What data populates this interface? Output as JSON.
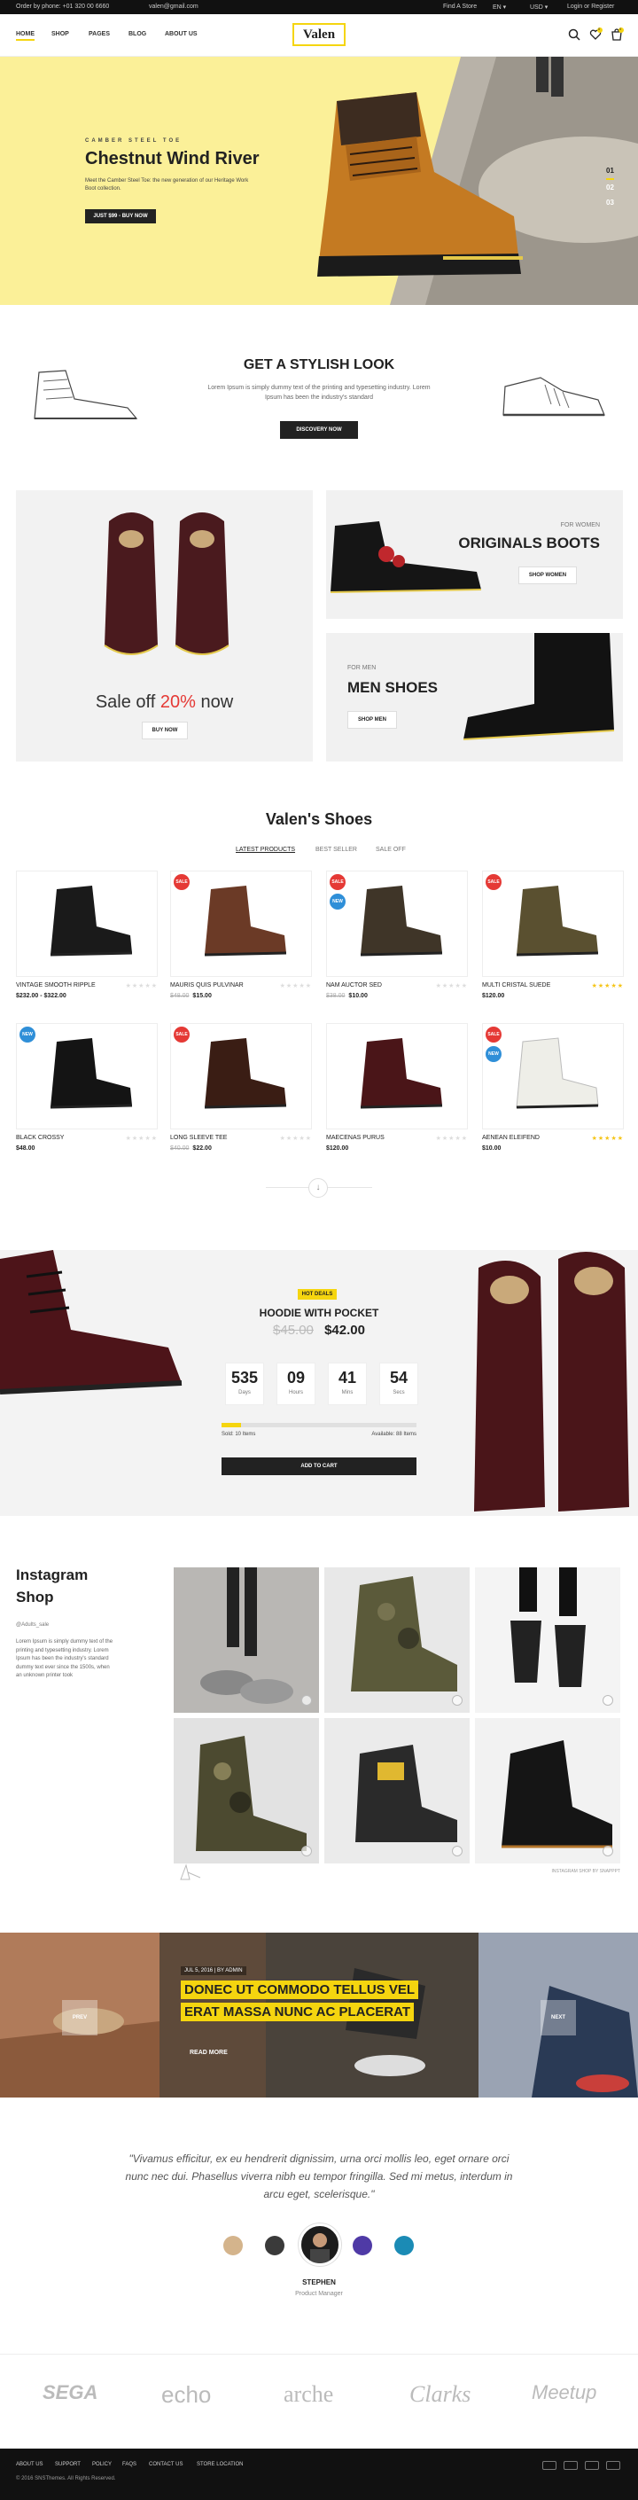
{
  "topbar": {
    "phone": "Order by phone: +01 320 00 6660",
    "email": "valen@gmail.com",
    "find_store": "Find A Store",
    "language": "EN",
    "currency": "USD",
    "login": "Login or Register"
  },
  "header": {
    "nav": [
      "HOME",
      "SHOP",
      "PAGES",
      "BLOG",
      "ABOUT US"
    ],
    "logo": "Valen",
    "cart_count": "0",
    "wishlist_count": "0"
  },
  "hero": {
    "eyebrow": "CAMBER STEEL TOE",
    "title": "Chestnut Wind River",
    "desc": "Meet the Camber Steel Toe: the new generation of our Heritage Work Boot collection.",
    "button": "JUST $99 - BUY NOW",
    "slides": [
      "01",
      "02",
      "03"
    ]
  },
  "stylish": {
    "title": "GET A STYLISH LOOK",
    "text": "Lorem Ipsum is simply dummy text of the printing and typesetting industry. Lorem Ipsum has been the industry's standard",
    "button": "DISCOVERY NOW"
  },
  "promo": {
    "sale_prefix": "Sale off",
    "sale_percent": "20%",
    "sale_suffix": "now",
    "sale_button": "BUY NOW",
    "women_label": "FOR WOMEN",
    "women_title": "ORIGINALS BOOTS",
    "women_button": "SHOP WOMEN",
    "men_label": "FOR MEN",
    "men_title": "MEN SHOES",
    "men_button": "SHOP MEN"
  },
  "products_section": {
    "title": "Valen's Shoes",
    "tabs": [
      "LATEST PRODUCTS",
      "BEST SELLER",
      "SALE OFF"
    ],
    "items": [
      {
        "name": "VINTAGE SMOOTH RIPPLE",
        "old": "",
        "price": "$232.00 - $322.00",
        "stars": 0,
        "color": "#1a1a1a"
      },
      {
        "name": "MAURIS QUIS PULVINAR",
        "old": "$48.00",
        "price": "$15.00",
        "stars": 0,
        "color": "#6b3a26",
        "badge": "SALE"
      },
      {
        "name": "NAM AUCTOR SED",
        "old": "$38.00",
        "price": "$10.00",
        "stars": 0,
        "color": "#3f3528",
        "badge": "SALE",
        "badge2": "NEW"
      },
      {
        "name": "MULTI CRISTAL SUEDE",
        "old": "",
        "price": "$120.00",
        "stars": 5,
        "color": "#5a5030",
        "badge": "SALE"
      },
      {
        "name": "BLACK CROSSY",
        "old": "",
        "price": "$48.00",
        "stars": 0,
        "color": "#141414",
        "badge2": "NEW"
      },
      {
        "name": "LONG SLEEVE TEE",
        "old": "$40.00",
        "price": "$22.00",
        "stars": 0,
        "color": "#3a1d14",
        "badge": "SALE"
      },
      {
        "name": "MAECENAS PURUS",
        "old": "",
        "price": "$120.00",
        "stars": 0,
        "color": "#4a1518"
      },
      {
        "name": "AENEAN ELEIFEND",
        "old": "",
        "price": "$10.00",
        "stars": 5,
        "color": "#eeeee8",
        "badge": "SALE",
        "badge2": "NEW"
      }
    ]
  },
  "deal": {
    "badge": "HOT DEALS",
    "title": "HOODIE WITH POCKET",
    "old_price": "$45.00",
    "price": "$42.00",
    "countdown": [
      {
        "value": "535",
        "label": "Days"
      },
      {
        "value": "09",
        "label": "Hours"
      },
      {
        "value": "41",
        "label": "Mins"
      },
      {
        "value": "54",
        "label": "Secs"
      }
    ],
    "sold": "Sold: 10 Items",
    "available": "Available: 88 Items",
    "sold_fraction": 0.1,
    "button": "ADD TO CART"
  },
  "instagram": {
    "title_line1": "Instagram",
    "title_line2": "Shop",
    "handle": "@Adults_sale",
    "text": "Lorem Ipsum is simply dummy text of the printing and typesetting industry. Lorem Ipsum has been the industry's standard dummy text ever since the 1500s, when an unknown printer took",
    "credit": "INSTAGRAM SHOP BY SNAPPPT"
  },
  "blog": {
    "prev": "PREV",
    "next": "NEXT",
    "date": "JUL 5, 2016",
    "author": "BY ADMIN",
    "title": "DONEC UT COMMODO TELLUS VEL ERAT MASSA NUNC AC PLACERAT",
    "button": "READ MORE"
  },
  "testimonial": {
    "quote": "\"Vivamus efficitur, ex eu hendrerit dignissim, urna orci mollis leo, eget ornare orci nunc nec dui. Phasellus viverra nibh eu tempor fringilla. Sed mi metus, interdum in arcu eget, scelerisque.\"",
    "name": "STEPHEN",
    "role": "Product Manager"
  },
  "brands": [
    "SEGA",
    "echo",
    "arche",
    "Clarks",
    "Meetup"
  ],
  "footer": {
    "links": [
      "ABOUT US",
      "SUPPORT",
      "POLICY",
      "FAQS",
      "CONTACT US",
      "STORE LOCATION"
    ],
    "copyright": "© 2016 SNSThemes. All Rights Reserved."
  }
}
